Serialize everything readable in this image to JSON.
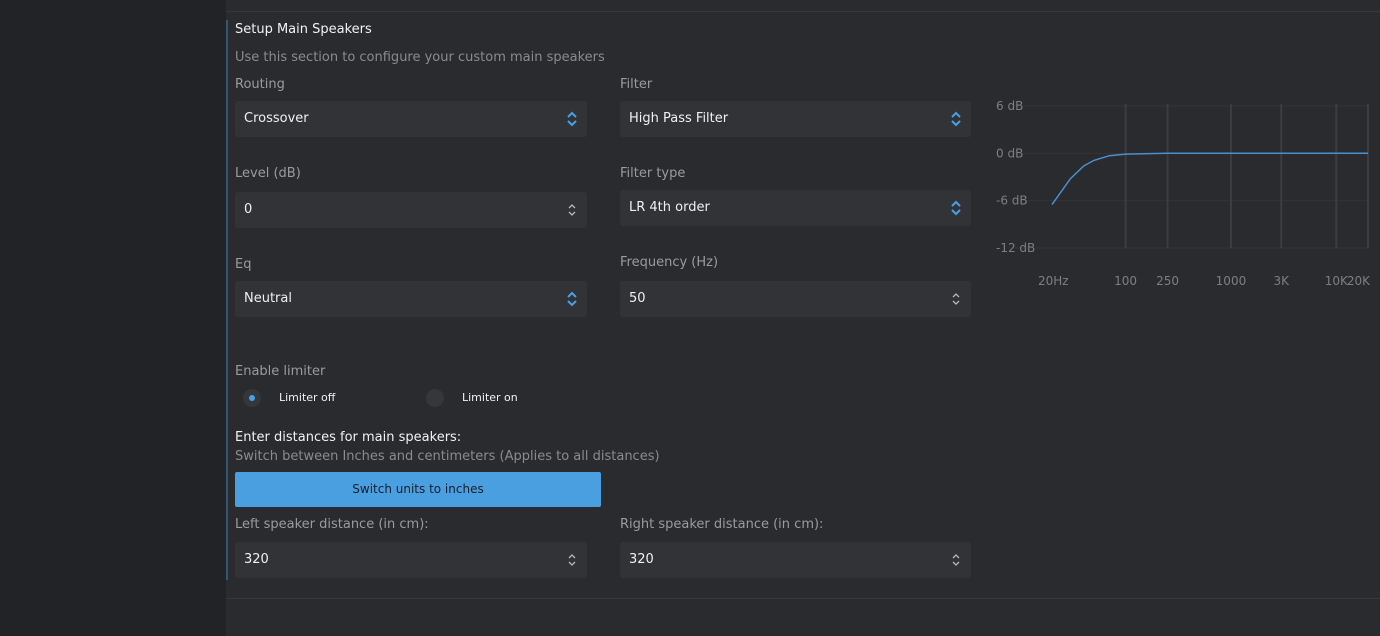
{
  "section": {
    "title": "Setup Main Speakers",
    "subtitle": "Use this section to configure your custom main speakers"
  },
  "routing": {
    "label": "Routing",
    "value": "Crossover"
  },
  "filter": {
    "label": "Filter",
    "value": "High Pass Filter"
  },
  "level": {
    "label": "Level (dB)",
    "value": "0"
  },
  "filter_type": {
    "label": "Filter type",
    "value": "LR 4th order"
  },
  "eq": {
    "label": "Eq",
    "value": "Neutral"
  },
  "frequency": {
    "label": "Frequency (Hz)",
    "value": "50"
  },
  "limiter": {
    "label": "Enable limiter",
    "options": [
      {
        "label": "Limiter off",
        "selected": true
      },
      {
        "label": "Limiter on",
        "selected": false
      }
    ]
  },
  "distances": {
    "heading": "Enter distances for main speakers:",
    "subheading": "Switch between Inches and centimeters (Applies to all distances)",
    "switch_button": "Switch units to inches",
    "left_label": "Left speaker distance (in cm):",
    "left_value": "320",
    "right_label": "Right speaker distance (in cm):",
    "right_value": "320"
  },
  "colors": {
    "accent": "#4a9fe0",
    "curve": "#4a8fcf",
    "background": "#2a2b2e",
    "field": "#323336"
  },
  "chart_data": {
    "type": "line",
    "title": "",
    "xlabel": "",
    "ylabel": "",
    "x_scale": "log",
    "x_ticks": [
      "20Hz",
      "100",
      "250",
      "1000",
      "3K",
      "10K",
      "20K"
    ],
    "y_ticks": [
      "6 dB",
      "0 dB",
      "-6 dB",
      "-12 dB"
    ],
    "ylim": [
      -12,
      6
    ],
    "xlim": [
      20,
      20000
    ],
    "grid": true,
    "series": [
      {
        "points": [
          [
            20,
            -6.5
          ],
          [
            30,
            -3.2
          ],
          [
            40,
            -1.6
          ],
          [
            50,
            -0.9
          ],
          [
            70,
            -0.3
          ],
          [
            100,
            -0.1
          ],
          [
            250,
            0
          ],
          [
            1000,
            0
          ],
          [
            3000,
            0
          ],
          [
            10000,
            0
          ],
          [
            20000,
            0
          ]
        ]
      }
    ]
  }
}
